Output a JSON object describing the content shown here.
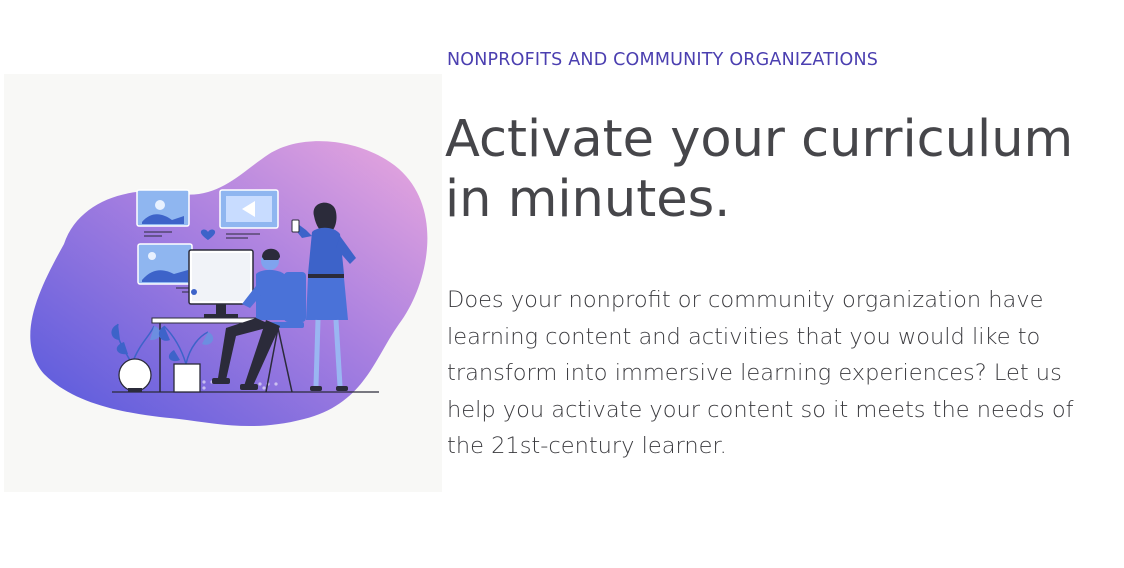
{
  "section": {
    "eyebrow": "NONPROFITS AND COMMUNITY ORGANIZATIONS",
    "headline": "Activate your curriculum in minutes.",
    "body": "Does your nonprofit or community organization have learning content and activities that you would like to transform into immersive learning experiences? Let us help you activate your content so it meets the needs of the 21st-century learner."
  },
  "colors": {
    "eyebrow": "#4b3fb0",
    "headline": "#46464a",
    "body": "#3b3b3f",
    "blob_start": "#5a5ce0",
    "blob_end": "#e2a4e0",
    "panel_bg": "#f8f8f6"
  },
  "illustration": {
    "description_icons": [
      "image-card-icon",
      "video-play-card-icon",
      "night-scene-card-icon",
      "heart-icon"
    ]
  }
}
